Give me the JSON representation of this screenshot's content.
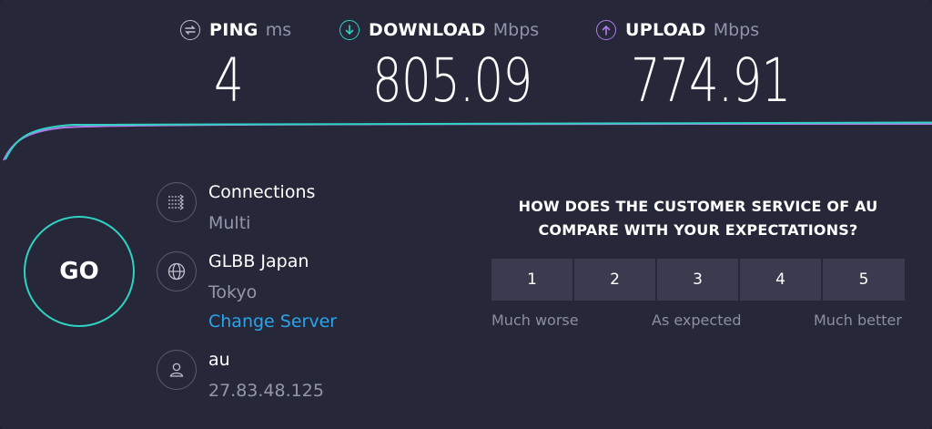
{
  "metrics": {
    "ping": {
      "label": "PING",
      "unit": "ms",
      "value": "4",
      "icon": "ping-icon",
      "color": "#bfc0cc"
    },
    "download": {
      "label": "DOWNLOAD",
      "unit": "Mbps",
      "value": "805.09",
      "icon": "download-icon",
      "color": "#2ed3c4"
    },
    "upload": {
      "label": "UPLOAD",
      "unit": "Mbps",
      "value": "774.91",
      "icon": "upload-icon",
      "color": "#b07ce8"
    }
  },
  "go_label": "GO",
  "connections": {
    "title": "Connections",
    "value": "Multi",
    "icon": "connections-icon"
  },
  "server": {
    "name": "GLBB Japan",
    "location": "Tokyo",
    "change_label": "Change Server",
    "icon": "globe-icon"
  },
  "isp": {
    "name": "au",
    "ip": "27.83.48.125",
    "icon": "user-icon"
  },
  "survey": {
    "question_line1": "HOW DOES THE CUSTOMER SERVICE OF AU",
    "question_line2": "COMPARE WITH YOUR EXPECTATIONS?",
    "ratings": [
      "1",
      "2",
      "3",
      "4",
      "5"
    ],
    "scale_low": "Much worse",
    "scale_mid": "As expected",
    "scale_high": "Much better"
  },
  "colors": {
    "background": "#262739",
    "accent_download": "#2ed3c4",
    "accent_upload": "#b07ce8",
    "link": "#27a6ee"
  }
}
